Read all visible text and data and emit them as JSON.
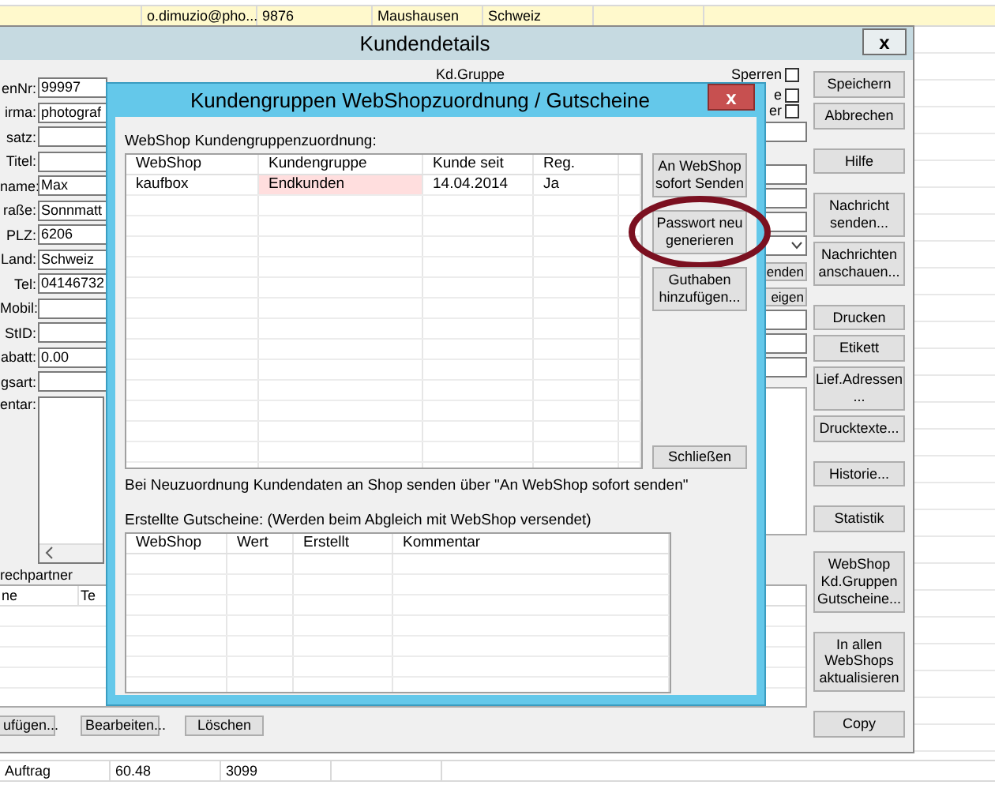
{
  "sheet": {
    "top_rows": [
      {
        "cells": [
          "o.dimuzio@pho...",
          "9876",
          "Maushausen",
          "Schweiz"
        ],
        "selected": true
      }
    ],
    "bottom_rows": [
      {
        "cells": [
          "Auftrag",
          "60.48",
          "3099"
        ],
        "selected": false
      }
    ]
  },
  "customer_window": {
    "title": "Kundendetails",
    "close": "x",
    "fields": [
      {
        "label": "enNr:",
        "value": "99997",
        "kind": "text"
      },
      {
        "label": "irma:",
        "value": "photograf",
        "kind": "text"
      },
      {
        "label": "satz:",
        "kind": "text"
      },
      {
        "label": "Titel:",
        "kind": "text"
      },
      {
        "label": "name:",
        "value": "Max",
        "kind": "text"
      },
      {
        "label": "raße:",
        "value": "Sonnmatt",
        "kind": "text"
      },
      {
        "label": "PLZ:",
        "value": "6206",
        "kind": "text"
      },
      {
        "label": "Land:",
        "value": "Schweiz",
        "kind": "text"
      },
      {
        "label": "Tel:",
        "value": "04146732",
        "kind": "text"
      },
      {
        "label": "Mobil:",
        "kind": "text"
      },
      {
        "label": "StID:",
        "kind": "text"
      },
      {
        "label": "abatt:",
        "value": "0.00",
        "kind": "text"
      },
      {
        "label": "gsart:",
        "kind": "text"
      },
      {
        "label": "entar:",
        "kind": "textarea"
      }
    ],
    "group_label": "Kd.Gruppe",
    "checkboxes": [
      {
        "label": "Sperren",
        "checked": false
      },
      {
        "label": "e",
        "checked": false
      },
      {
        "label": "er",
        "checked": false
      }
    ],
    "side_buttons": [
      "enden",
      "eigen"
    ],
    "button_groups": [
      [
        "Speichern",
        "Abbrechen"
      ],
      [
        "Hilfe"
      ],
      [
        "Nachricht senden...",
        "Nachrichten anschauen..."
      ],
      [
        "Drucken",
        "Etikett",
        "Lief.Adressen ...",
        "Drucktexte..."
      ],
      [
        "Historie..."
      ],
      [
        "Statistik"
      ],
      [
        "WebShop Kd.Gruppen Gutscheine..."
      ],
      [
        "In allen WebShops aktualisieren"
      ],
      [
        "Copy"
      ]
    ],
    "contacts": {
      "tab": "rechpartner",
      "columns": [
        "ne",
        "Te"
      ],
      "buttons": [
        "ufügen...",
        "Bearbeiten...",
        "Löschen"
      ]
    }
  },
  "dialog": {
    "title": "Kundengruppen WebShopzuordnung / Gutscheine",
    "close": "x",
    "assignment_label": "WebShop Kundengruppenzuordnung:",
    "assignment_table": {
      "columns": [
        "WebShop",
        "Kundengruppe",
        "Kunde seit",
        "Reg."
      ],
      "rows": [
        {
          "cells": [
            {
              "text": "kaufbox",
              "highlighted": false
            },
            {
              "text": "Endkunden",
              "highlighted": true
            },
            {
              "text": "14.04.2014",
              "highlighted": false
            },
            {
              "text": "Ja",
              "highlighted": false
            }
          ]
        }
      ]
    },
    "actions": [
      {
        "label": "An WebShop sofort Senden",
        "circled": false
      },
      {
        "label": "Passwort neu generieren",
        "circled": true
      },
      {
        "label": "Guthaben hinzufügen...",
        "circled": false
      }
    ],
    "close_button": "Schließen",
    "note": "Bei Neuzuordnung Kundendaten an Shop senden über \"An WebShop sofort senden\"",
    "vouchers_label": "Erstellte Gutscheine: (Werden beim Abgleich mit WebShop versendet)",
    "vouchers_table": {
      "columns": [
        "WebShop",
        "Wert",
        "Erstellt",
        "Kommentar"
      ]
    }
  }
}
